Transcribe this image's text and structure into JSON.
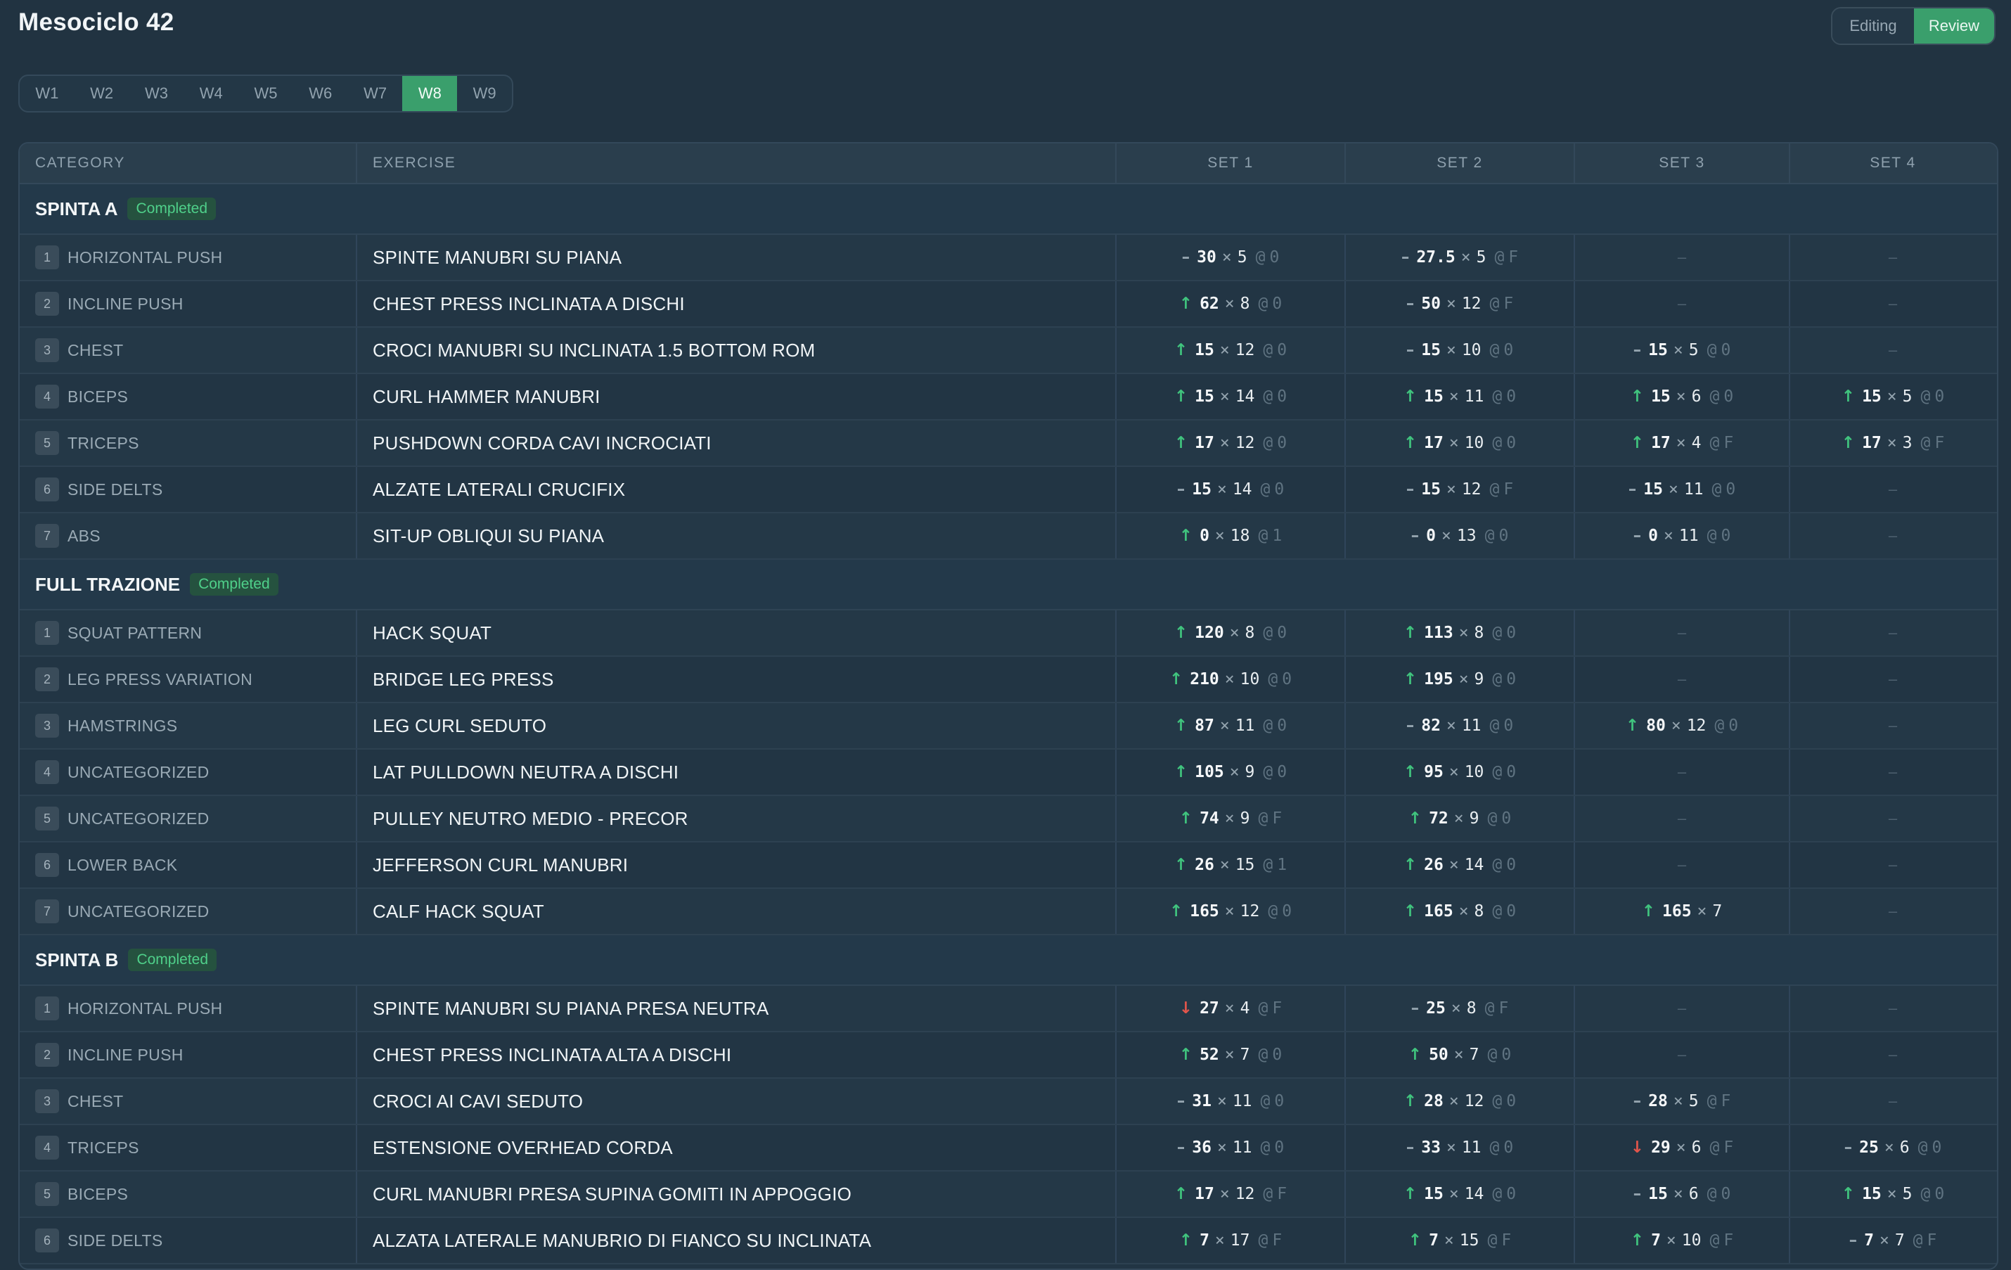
{
  "title": "Mesociclo 42",
  "modes": [
    "Editing",
    "Review"
  ],
  "active_mode": "Review",
  "weeks": [
    "W1",
    "W2",
    "W3",
    "W4",
    "W5",
    "W6",
    "W7",
    "W8",
    "W9"
  ],
  "active_week": "W8",
  "columns": [
    "CATEGORY",
    "EXERCISE",
    "SET 1",
    "SET 2",
    "SET 3",
    "SET 4"
  ],
  "colors": {
    "accent": "#3a9f6c",
    "up": "#40c47e",
    "down": "#e2554b",
    "flat": "#93a3ae"
  },
  "groups": [
    {
      "name": "SPINTA A",
      "status": "Completed",
      "rows": [
        {
          "n": "1",
          "cat": "HORIZONTAL PUSH",
          "ex": "SPINTE MANUBRI SU PIANA",
          "sets": [
            {
              "t": "same",
              "w": "30",
              "r": "5",
              "rir": "0"
            },
            {
              "t": "same",
              "w": "27.5",
              "r": "5",
              "rir": "F"
            },
            null,
            null
          ]
        },
        {
          "n": "2",
          "cat": "INCLINE PUSH",
          "ex": "CHEST PRESS INCLINATA A DISCHI",
          "sets": [
            {
              "t": "up",
              "w": "62",
              "r": "8",
              "rir": "0"
            },
            {
              "t": "same",
              "w": "50",
              "r": "12",
              "rir": "F"
            },
            null,
            null
          ]
        },
        {
          "n": "3",
          "cat": "CHEST",
          "ex": "CROCI MANUBRI SU INCLINATA 1.5 BOTTOM ROM",
          "sets": [
            {
              "t": "up",
              "w": "15",
              "r": "12",
              "rir": "0"
            },
            {
              "t": "same",
              "w": "15",
              "r": "10",
              "rir": "0"
            },
            {
              "t": "same",
              "w": "15",
              "r": "5",
              "rir": "0"
            },
            null
          ]
        },
        {
          "n": "4",
          "cat": "BICEPS",
          "ex": "CURL HAMMER MANUBRI",
          "sets": [
            {
              "t": "up",
              "w": "15",
              "r": "14",
              "rir": "0"
            },
            {
              "t": "up",
              "w": "15",
              "r": "11",
              "rir": "0"
            },
            {
              "t": "up",
              "w": "15",
              "r": "6",
              "rir": "0"
            },
            {
              "t": "up",
              "w": "15",
              "r": "5",
              "rir": "0"
            }
          ]
        },
        {
          "n": "5",
          "cat": "TRICEPS",
          "ex": "PUSHDOWN CORDA CAVI INCROCIATI",
          "sets": [
            {
              "t": "up",
              "w": "17",
              "r": "12",
              "rir": "0"
            },
            {
              "t": "up",
              "w": "17",
              "r": "10",
              "rir": "0"
            },
            {
              "t": "up",
              "w": "17",
              "r": "4",
              "rir": "F"
            },
            {
              "t": "up",
              "w": "17",
              "r": "3",
              "rir": "F"
            }
          ]
        },
        {
          "n": "6",
          "cat": "SIDE DELTS",
          "ex": "ALZATE LATERALI CRUCIFIX",
          "sets": [
            {
              "t": "same",
              "w": "15",
              "r": "14",
              "rir": "0"
            },
            {
              "t": "same",
              "w": "15",
              "r": "12",
              "rir": "F"
            },
            {
              "t": "same",
              "w": "15",
              "r": "11",
              "rir": "0"
            },
            null
          ]
        },
        {
          "n": "7",
          "cat": "ABS",
          "ex": "SIT-UP OBLIQUI SU PIANA",
          "sets": [
            {
              "t": "up",
              "w": "0",
              "r": "18",
              "rir": "1"
            },
            {
              "t": "same",
              "w": "0",
              "r": "13",
              "rir": "0"
            },
            {
              "t": "same",
              "w": "0",
              "r": "11",
              "rir": "0"
            },
            null
          ]
        }
      ]
    },
    {
      "name": "FULL TRAZIONE",
      "status": "Completed",
      "rows": [
        {
          "n": "1",
          "cat": "SQUAT PATTERN",
          "ex": "HACK SQUAT",
          "sets": [
            {
              "t": "up",
              "w": "120",
              "r": "8",
              "rir": "0"
            },
            {
              "t": "up",
              "w": "113",
              "r": "8",
              "rir": "0"
            },
            null,
            null
          ]
        },
        {
          "n": "2",
          "cat": "LEG PRESS VARIATION",
          "ex": "BRIDGE LEG PRESS",
          "sets": [
            {
              "t": "up",
              "w": "210",
              "r": "10",
              "rir": "0"
            },
            {
              "t": "up",
              "w": "195",
              "r": "9",
              "rir": "0"
            },
            null,
            null
          ]
        },
        {
          "n": "3",
          "cat": "HAMSTRINGS",
          "ex": "LEG CURL SEDUTO",
          "sets": [
            {
              "t": "up",
              "w": "87",
              "r": "11",
              "rir": "0"
            },
            {
              "t": "same",
              "w": "82",
              "r": "11",
              "rir": "0"
            },
            {
              "t": "up",
              "w": "80",
              "r": "12",
              "rir": "0"
            },
            null
          ]
        },
        {
          "n": "4",
          "cat": "UNCATEGORIZED",
          "ex": "LAT PULLDOWN NEUTRA A DISCHI",
          "sets": [
            {
              "t": "up",
              "w": "105",
              "r": "9",
              "rir": "0"
            },
            {
              "t": "up",
              "w": "95",
              "r": "10",
              "rir": "0"
            },
            null,
            null
          ]
        },
        {
          "n": "5",
          "cat": "UNCATEGORIZED",
          "ex": "PULLEY NEUTRO MEDIO - PRECOR",
          "sets": [
            {
              "t": "up",
              "w": "74",
              "r": "9",
              "rir": "F"
            },
            {
              "t": "up",
              "w": "72",
              "r": "9",
              "rir": "0"
            },
            null,
            null
          ]
        },
        {
          "n": "6",
          "cat": "LOWER BACK",
          "ex": "JEFFERSON CURL MANUBRI",
          "sets": [
            {
              "t": "up",
              "w": "26",
              "r": "15",
              "rir": "1"
            },
            {
              "t": "up",
              "w": "26",
              "r": "14",
              "rir": "0"
            },
            null,
            null
          ]
        },
        {
          "n": "7",
          "cat": "UNCATEGORIZED",
          "ex": "CALF HACK SQUAT",
          "sets": [
            {
              "t": "up",
              "w": "165",
              "r": "12",
              "rir": "0"
            },
            {
              "t": "up",
              "w": "165",
              "r": "8",
              "rir": "0"
            },
            {
              "t": "up",
              "w": "165",
              "r": "7",
              "rir": ""
            },
            null
          ]
        }
      ]
    },
    {
      "name": "SPINTA B",
      "status": "Completed",
      "rows": [
        {
          "n": "1",
          "cat": "HORIZONTAL PUSH",
          "ex": "SPINTE MANUBRI SU PIANA PRESA NEUTRA",
          "sets": [
            {
              "t": "down",
              "w": "27",
              "r": "4",
              "rir": "F"
            },
            {
              "t": "same",
              "w": "25",
              "r": "8",
              "rir": "F"
            },
            null,
            null
          ]
        },
        {
          "n": "2",
          "cat": "INCLINE PUSH",
          "ex": "CHEST PRESS INCLINATA ALTA A DISCHI",
          "sets": [
            {
              "t": "up",
              "w": "52",
              "r": "7",
              "rir": "0"
            },
            {
              "t": "up",
              "w": "50",
              "r": "7",
              "rir": "0"
            },
            null,
            null
          ]
        },
        {
          "n": "3",
          "cat": "CHEST",
          "ex": "CROCI AI CAVI SEDUTO",
          "sets": [
            {
              "t": "same",
              "w": "31",
              "r": "11",
              "rir": "0"
            },
            {
              "t": "up",
              "w": "28",
              "r": "12",
              "rir": "0"
            },
            {
              "t": "same",
              "w": "28",
              "r": "5",
              "rir": "F"
            },
            null
          ]
        },
        {
          "n": "4",
          "cat": "TRICEPS",
          "ex": "ESTENSIONE OVERHEAD CORDA",
          "sets": [
            {
              "t": "same",
              "w": "36",
              "r": "11",
              "rir": "0"
            },
            {
              "t": "same",
              "w": "33",
              "r": "11",
              "rir": "0"
            },
            {
              "t": "down",
              "w": "29",
              "r": "6",
              "rir": "F"
            },
            {
              "t": "same",
              "w": "25",
              "r": "6",
              "rir": "0"
            }
          ]
        },
        {
          "n": "5",
          "cat": "BICEPS",
          "ex": "CURL MANUBRI PRESA SUPINA GOMITI IN APPOGGIO",
          "sets": [
            {
              "t": "up",
              "w": "17",
              "r": "12",
              "rir": "F"
            },
            {
              "t": "up",
              "w": "15",
              "r": "14",
              "rir": "0"
            },
            {
              "t": "same",
              "w": "15",
              "r": "6",
              "rir": "0"
            },
            {
              "t": "up",
              "w": "15",
              "r": "5",
              "rir": "0"
            }
          ]
        },
        {
          "n": "6",
          "cat": "SIDE DELTS",
          "ex": "ALZATA LATERALE MANUBRIO DI FIANCO SU INCLINATA",
          "sets": [
            {
              "t": "up",
              "w": "7",
              "r": "17",
              "rir": "F"
            },
            {
              "t": "up",
              "w": "7",
              "r": "15",
              "rir": "F"
            },
            {
              "t": "up",
              "w": "7",
              "r": "10",
              "rir": "F"
            },
            {
              "t": "same",
              "w": "7",
              "r": "7",
              "rir": "F"
            }
          ]
        }
      ]
    }
  ],
  "symbols": {
    "up": "↑",
    "down": "↓",
    "same": "–",
    "times": "×",
    "at": "@",
    "empty": "–"
  }
}
